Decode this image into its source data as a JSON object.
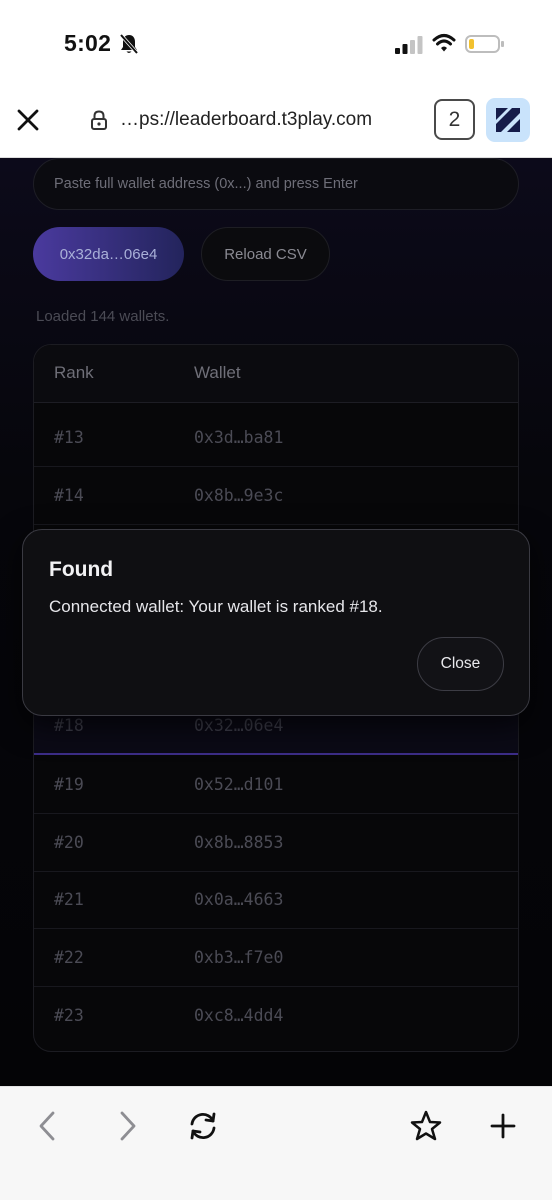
{
  "status_bar": {
    "time": "5:02",
    "icons": [
      "bell-slash-icon",
      "signal-icon",
      "wifi-icon",
      "battery-icon"
    ],
    "battery_color": "#f2c12e"
  },
  "browser": {
    "url": "…ps://leaderboard.t3play.com",
    "tab_count": "2",
    "icons": [
      "close-icon",
      "lock-icon",
      "extension-icon"
    ],
    "extension_bg": "#c9e3fb"
  },
  "page": {
    "search": {
      "placeholder": "Paste full wallet address (0x...) and press Enter",
      "value": ""
    },
    "wallet_chip": "0x32da…06e4",
    "reload_label": "Reload CSV",
    "loaded_text": "Loaded 144 wallets.",
    "accent_color": "#4a3a9e",
    "table": {
      "headers": {
        "rank": "Rank",
        "wallet": "Wallet"
      },
      "rows": [
        {
          "rank": "#13",
          "wallet": "0x3d…ba81"
        },
        {
          "rank": "#14",
          "wallet": "0x8b…9e3c"
        },
        {
          "rank": "#18",
          "wallet": "0x32…06e4",
          "highlight": true
        },
        {
          "rank": "#19",
          "wallet": "0x52…d101"
        },
        {
          "rank": "#20",
          "wallet": "0x8b…8853"
        },
        {
          "rank": "#21",
          "wallet": "0x0a…4663"
        },
        {
          "rank": "#22",
          "wallet": "0xb3…f7e0"
        },
        {
          "rank": "#23",
          "wallet": "0xc8…4dd4"
        }
      ]
    }
  },
  "dialog": {
    "title": "Found",
    "message": "Connected wallet: Your wallet is ranked #18.",
    "close_label": "Close"
  },
  "bottom_bar": {
    "icons": [
      "back-icon",
      "forward-icon",
      "reload-icon",
      "bookmark-star-icon",
      "new-tab-plus-icon"
    ]
  }
}
